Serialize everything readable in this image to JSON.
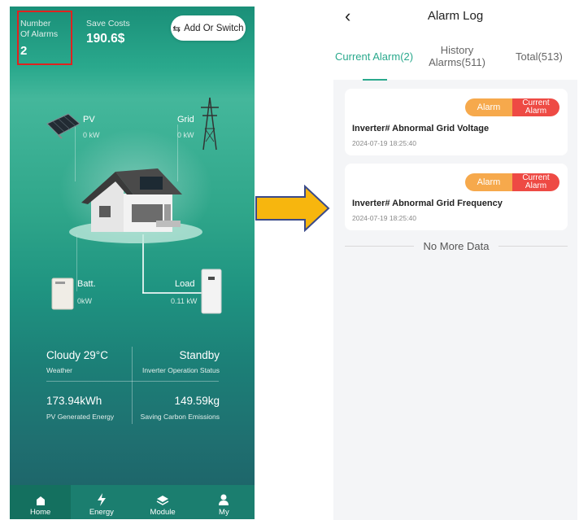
{
  "left": {
    "alarms_label": "Number\nOf Alarms",
    "alarms_count": "2",
    "save_costs_label": "Save Costs",
    "save_costs_value": "190.6$",
    "switch_label": "Add Or Switch",
    "pv": {
      "name": "PV",
      "value": "0 kW"
    },
    "grid": {
      "name": "Grid",
      "value": "0 kW"
    },
    "batt": {
      "name": "Batt.",
      "value": "0kW"
    },
    "load": {
      "name": "Load",
      "value": "0.11 kW"
    },
    "weather": {
      "value": "Cloudy 29°C",
      "label": "Weather"
    },
    "status": {
      "value": "Standby",
      "label": "Inverter Operation Status"
    },
    "pv_energy": {
      "value": "173.94kWh",
      "label": "PV Generated Energy"
    },
    "carbon": {
      "value": "149.59kg",
      "label": "Saving Carbon Emissions"
    },
    "nav": [
      {
        "label": "Home",
        "icon": "home-icon"
      },
      {
        "label": "Energy",
        "icon": "lightning-icon"
      },
      {
        "label": "Module",
        "icon": "layers-icon"
      },
      {
        "label": "My",
        "icon": "user-icon"
      }
    ],
    "colors": {
      "alarm_highlight": "#e0221f",
      "arrow": "#f7b60e"
    }
  },
  "right": {
    "title": "Alarm Log",
    "tabs": [
      {
        "label": "Current Alarm(2)",
        "active": true
      },
      {
        "label": "History\nAlarms(511)",
        "active": false
      },
      {
        "label": "Total(513)",
        "active": false
      }
    ],
    "alarms": [
      {
        "title": "Inverter# Abnormal Grid Voltage",
        "time": "2024-07-19 18:25:40",
        "badge_alarm": "Alarm",
        "badge_status": "Current\nAlarm"
      },
      {
        "title": "Inverter# Abnormal Grid Frequency",
        "time": "2024-07-19 18:25:40",
        "badge_alarm": "Alarm",
        "badge_status": "Current\nAlarm"
      }
    ],
    "no_more": "No More Data",
    "colors": {
      "accent": "#2aa98d",
      "badge_alarm": "#f6a94c",
      "badge_current": "#ee4a44"
    }
  }
}
